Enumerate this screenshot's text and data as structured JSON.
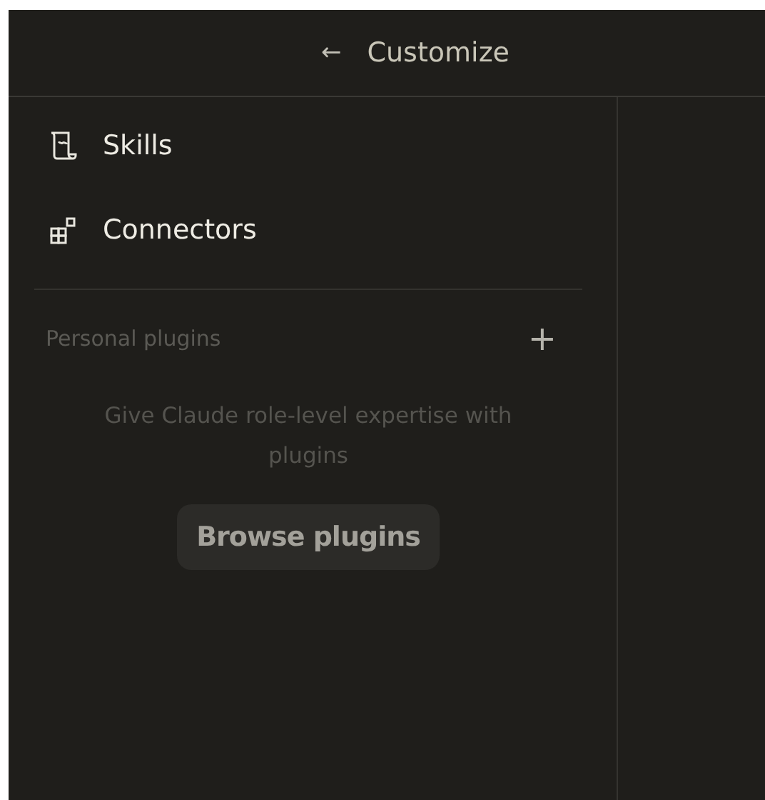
{
  "header": {
    "back": "←",
    "title": "Customize"
  },
  "nav": [
    {
      "kind": "skills",
      "label": "Skills"
    },
    {
      "kind": "connectors",
      "label": "Connectors"
    }
  ],
  "section": {
    "title": "Personal plugins",
    "add": "+",
    "description": "Give Claude role-level expertise with plugins",
    "button": "Browse plugins"
  }
}
